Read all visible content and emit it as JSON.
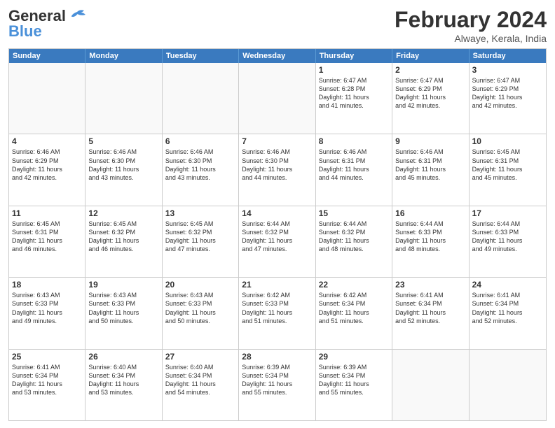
{
  "header": {
    "logo_general": "General",
    "logo_blue": "Blue",
    "month_title": "February 2024",
    "location": "Alwaye, Kerala, India"
  },
  "days_of_week": [
    "Sunday",
    "Monday",
    "Tuesday",
    "Wednesday",
    "Thursday",
    "Friday",
    "Saturday"
  ],
  "weeks": [
    [
      {
        "day": "",
        "info": ""
      },
      {
        "day": "",
        "info": ""
      },
      {
        "day": "",
        "info": ""
      },
      {
        "day": "",
        "info": ""
      },
      {
        "day": "1",
        "info": "Sunrise: 6:47 AM\nSunset: 6:28 PM\nDaylight: 11 hours\nand 41 minutes."
      },
      {
        "day": "2",
        "info": "Sunrise: 6:47 AM\nSunset: 6:29 PM\nDaylight: 11 hours\nand 42 minutes."
      },
      {
        "day": "3",
        "info": "Sunrise: 6:47 AM\nSunset: 6:29 PM\nDaylight: 11 hours\nand 42 minutes."
      }
    ],
    [
      {
        "day": "4",
        "info": "Sunrise: 6:46 AM\nSunset: 6:29 PM\nDaylight: 11 hours\nand 42 minutes."
      },
      {
        "day": "5",
        "info": "Sunrise: 6:46 AM\nSunset: 6:30 PM\nDaylight: 11 hours\nand 43 minutes."
      },
      {
        "day": "6",
        "info": "Sunrise: 6:46 AM\nSunset: 6:30 PM\nDaylight: 11 hours\nand 43 minutes."
      },
      {
        "day": "7",
        "info": "Sunrise: 6:46 AM\nSunset: 6:30 PM\nDaylight: 11 hours\nand 44 minutes."
      },
      {
        "day": "8",
        "info": "Sunrise: 6:46 AM\nSunset: 6:31 PM\nDaylight: 11 hours\nand 44 minutes."
      },
      {
        "day": "9",
        "info": "Sunrise: 6:46 AM\nSunset: 6:31 PM\nDaylight: 11 hours\nand 45 minutes."
      },
      {
        "day": "10",
        "info": "Sunrise: 6:45 AM\nSunset: 6:31 PM\nDaylight: 11 hours\nand 45 minutes."
      }
    ],
    [
      {
        "day": "11",
        "info": "Sunrise: 6:45 AM\nSunset: 6:31 PM\nDaylight: 11 hours\nand 46 minutes."
      },
      {
        "day": "12",
        "info": "Sunrise: 6:45 AM\nSunset: 6:32 PM\nDaylight: 11 hours\nand 46 minutes."
      },
      {
        "day": "13",
        "info": "Sunrise: 6:45 AM\nSunset: 6:32 PM\nDaylight: 11 hours\nand 47 minutes."
      },
      {
        "day": "14",
        "info": "Sunrise: 6:44 AM\nSunset: 6:32 PM\nDaylight: 11 hours\nand 47 minutes."
      },
      {
        "day": "15",
        "info": "Sunrise: 6:44 AM\nSunset: 6:32 PM\nDaylight: 11 hours\nand 48 minutes."
      },
      {
        "day": "16",
        "info": "Sunrise: 6:44 AM\nSunset: 6:33 PM\nDaylight: 11 hours\nand 48 minutes."
      },
      {
        "day": "17",
        "info": "Sunrise: 6:44 AM\nSunset: 6:33 PM\nDaylight: 11 hours\nand 49 minutes."
      }
    ],
    [
      {
        "day": "18",
        "info": "Sunrise: 6:43 AM\nSunset: 6:33 PM\nDaylight: 11 hours\nand 49 minutes."
      },
      {
        "day": "19",
        "info": "Sunrise: 6:43 AM\nSunset: 6:33 PM\nDaylight: 11 hours\nand 50 minutes."
      },
      {
        "day": "20",
        "info": "Sunrise: 6:43 AM\nSunset: 6:33 PM\nDaylight: 11 hours\nand 50 minutes."
      },
      {
        "day": "21",
        "info": "Sunrise: 6:42 AM\nSunset: 6:33 PM\nDaylight: 11 hours\nand 51 minutes."
      },
      {
        "day": "22",
        "info": "Sunrise: 6:42 AM\nSunset: 6:34 PM\nDaylight: 11 hours\nand 51 minutes."
      },
      {
        "day": "23",
        "info": "Sunrise: 6:41 AM\nSunset: 6:34 PM\nDaylight: 11 hours\nand 52 minutes."
      },
      {
        "day": "24",
        "info": "Sunrise: 6:41 AM\nSunset: 6:34 PM\nDaylight: 11 hours\nand 52 minutes."
      }
    ],
    [
      {
        "day": "25",
        "info": "Sunrise: 6:41 AM\nSunset: 6:34 PM\nDaylight: 11 hours\nand 53 minutes."
      },
      {
        "day": "26",
        "info": "Sunrise: 6:40 AM\nSunset: 6:34 PM\nDaylight: 11 hours\nand 53 minutes."
      },
      {
        "day": "27",
        "info": "Sunrise: 6:40 AM\nSunset: 6:34 PM\nDaylight: 11 hours\nand 54 minutes."
      },
      {
        "day": "28",
        "info": "Sunrise: 6:39 AM\nSunset: 6:34 PM\nDaylight: 11 hours\nand 55 minutes."
      },
      {
        "day": "29",
        "info": "Sunrise: 6:39 AM\nSunset: 6:34 PM\nDaylight: 11 hours\nand 55 minutes."
      },
      {
        "day": "",
        "info": ""
      },
      {
        "day": "",
        "info": ""
      }
    ]
  ]
}
